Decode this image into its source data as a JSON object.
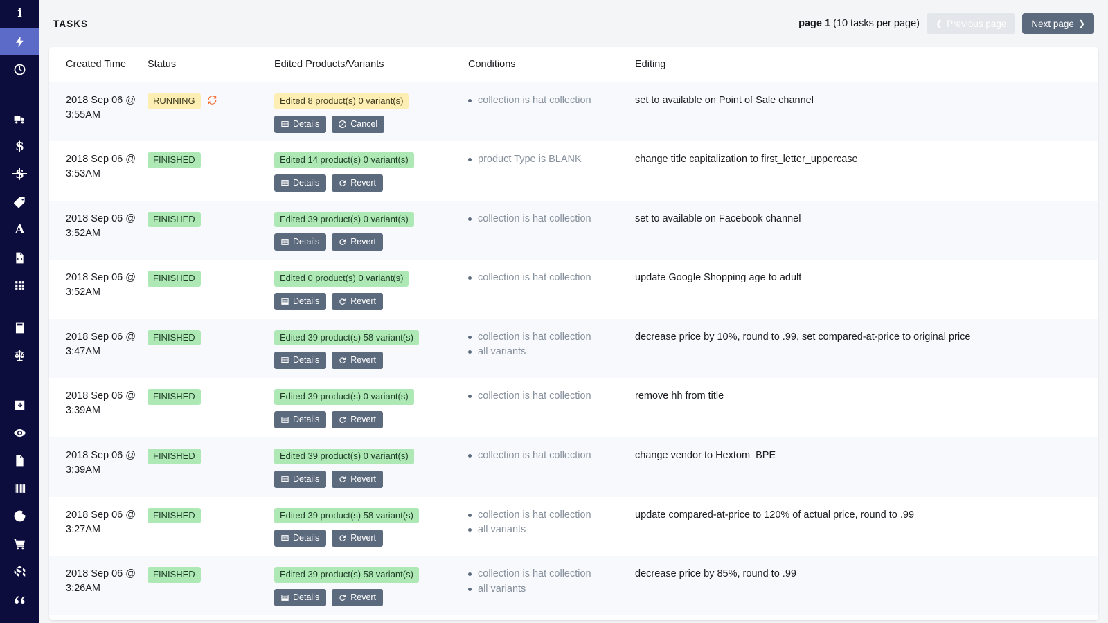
{
  "sidebar": {
    "items": [
      {
        "name": "info-icon",
        "icon": "info",
        "active": false
      },
      {
        "name": "bolt-icon",
        "icon": "bolt",
        "active": true
      },
      {
        "name": "clock-icon",
        "icon": "clock",
        "active": false
      },
      {
        "name": "truck-icon",
        "icon": "truck",
        "active": false
      },
      {
        "name": "dollar-icon",
        "icon": "dollar",
        "active": false
      },
      {
        "name": "dollar-strike-icon",
        "icon": "dollar-strike",
        "active": false
      },
      {
        "name": "tag-icon",
        "icon": "tag",
        "active": false
      },
      {
        "name": "letter-a-icon",
        "icon": "letter-a",
        "active": false
      },
      {
        "name": "code-file-icon",
        "icon": "code-file",
        "active": false
      },
      {
        "name": "grid-icon",
        "icon": "grid",
        "active": false
      },
      {
        "name": "calculator-icon",
        "icon": "calculator",
        "active": false
      },
      {
        "name": "scales-icon",
        "icon": "scales",
        "active": false
      },
      {
        "name": "inbox-down-icon",
        "icon": "inbox-down",
        "active": false
      },
      {
        "name": "eye-icon",
        "icon": "eye",
        "active": false
      },
      {
        "name": "document-icon",
        "icon": "document",
        "active": false
      },
      {
        "name": "barcode-icon",
        "icon": "barcode",
        "active": false
      },
      {
        "name": "google-icon",
        "icon": "google",
        "active": false
      },
      {
        "name": "cart-icon",
        "icon": "cart",
        "active": false
      },
      {
        "name": "boxes-icon",
        "icon": "boxes",
        "active": false
      },
      {
        "name": "quote-icon",
        "icon": "quote",
        "active": false
      }
    ],
    "accent_active": "#5c6bc8",
    "background": "#0d0d3d"
  },
  "header": {
    "title": "TASKS",
    "pagination": {
      "info_bold": "page 1",
      "info_rest": " (10 tasks per page)",
      "previous_label": "Previous page",
      "next_label": "Next page",
      "previous_disabled": true
    }
  },
  "table": {
    "columns": [
      "Created Time",
      "Status",
      "Edited Products/Variants",
      "Conditions",
      "Editing"
    ],
    "rows": [
      {
        "created_time": "2018 Sep 06 @ 3:55AM",
        "status": "RUNNING",
        "status_type": "running",
        "has_spinner": true,
        "edited": "Edited 8 product(s) 0 variant(s)",
        "edited_type": "running",
        "actions": [
          "Details",
          "Cancel"
        ],
        "action_types": [
          "details",
          "cancel"
        ],
        "conditions": [
          "collection is hat collection"
        ],
        "editing": "set to available on Point of Sale channel"
      },
      {
        "created_time": "2018 Sep 06 @ 3:53AM",
        "status": "FINISHED",
        "status_type": "finished",
        "has_spinner": false,
        "edited": "Edited 14 product(s) 0 variant(s)",
        "edited_type": "finished",
        "actions": [
          "Details",
          "Revert"
        ],
        "action_types": [
          "details",
          "revert"
        ],
        "conditions": [
          "product Type is BLANK"
        ],
        "editing": "change title capitalization to first_letter_uppercase"
      },
      {
        "created_time": "2018 Sep 06 @ 3:52AM",
        "status": "FINISHED",
        "status_type": "finished",
        "has_spinner": false,
        "edited": "Edited 39 product(s) 0 variant(s)",
        "edited_type": "finished",
        "actions": [
          "Details",
          "Revert"
        ],
        "action_types": [
          "details",
          "revert"
        ],
        "conditions": [
          "collection is hat collection"
        ],
        "editing": "set to available on Facebook channel"
      },
      {
        "created_time": "2018 Sep 06 @ 3:52AM",
        "status": "FINISHED",
        "status_type": "finished",
        "has_spinner": false,
        "edited": "Edited 0 product(s) 0 variant(s)",
        "edited_type": "finished",
        "actions": [
          "Details",
          "Revert"
        ],
        "action_types": [
          "details",
          "revert"
        ],
        "conditions": [
          "collection is hat collection"
        ],
        "editing": "update Google Shopping age to adult"
      },
      {
        "created_time": "2018 Sep 06 @ 3:47AM",
        "status": "FINISHED",
        "status_type": "finished",
        "has_spinner": false,
        "edited": "Edited 39 product(s) 58 variant(s)",
        "edited_type": "finished",
        "actions": [
          "Details",
          "Revert"
        ],
        "action_types": [
          "details",
          "revert"
        ],
        "conditions": [
          "collection is hat collection",
          "all variants"
        ],
        "editing": "decrease price by 10%, round to .99, set compared-at-price to original price"
      },
      {
        "created_time": "2018 Sep 06 @ 3:39AM",
        "status": "FINISHED",
        "status_type": "finished",
        "has_spinner": false,
        "edited": "Edited 39 product(s) 0 variant(s)",
        "edited_type": "finished",
        "actions": [
          "Details",
          "Revert"
        ],
        "action_types": [
          "details",
          "revert"
        ],
        "conditions": [
          "collection is hat collection"
        ],
        "editing": "remove hh from title"
      },
      {
        "created_time": "2018 Sep 06 @ 3:39AM",
        "status": "FINISHED",
        "status_type": "finished",
        "has_spinner": false,
        "edited": "Edited 39 product(s) 0 variant(s)",
        "edited_type": "finished",
        "actions": [
          "Details",
          "Revert"
        ],
        "action_types": [
          "details",
          "revert"
        ],
        "conditions": [
          "collection is hat collection"
        ],
        "editing": "change vendor to Hextom_BPE"
      },
      {
        "created_time": "2018 Sep 06 @ 3:27AM",
        "status": "FINISHED",
        "status_type": "finished",
        "has_spinner": false,
        "edited": "Edited 39 product(s) 58 variant(s)",
        "edited_type": "finished",
        "actions": [
          "Details",
          "Revert"
        ],
        "action_types": [
          "details",
          "revert"
        ],
        "conditions": [
          "collection is hat collection",
          "all variants"
        ],
        "editing": "update compared-at-price to 120% of actual price, round to .99"
      },
      {
        "created_time": "2018 Sep 06 @ 3:26AM",
        "status": "FINISHED",
        "status_type": "finished",
        "has_spinner": false,
        "edited": "Edited 39 product(s) 58 variant(s)",
        "edited_type": "finished",
        "actions": [
          "Details",
          "Revert"
        ],
        "action_types": [
          "details",
          "revert"
        ],
        "conditions": [
          "collection is hat collection",
          "all variants"
        ],
        "editing": "decrease price by 85%, round to .99"
      }
    ]
  },
  "colors": {
    "running_badge": "#fdeeb3",
    "finished_badge": "#aee9b5",
    "button": "#5c6a7e",
    "spinner": "#f26b2a",
    "sidebar": "#0d0d3d",
    "sidebar_active": "#5c6bc8"
  }
}
